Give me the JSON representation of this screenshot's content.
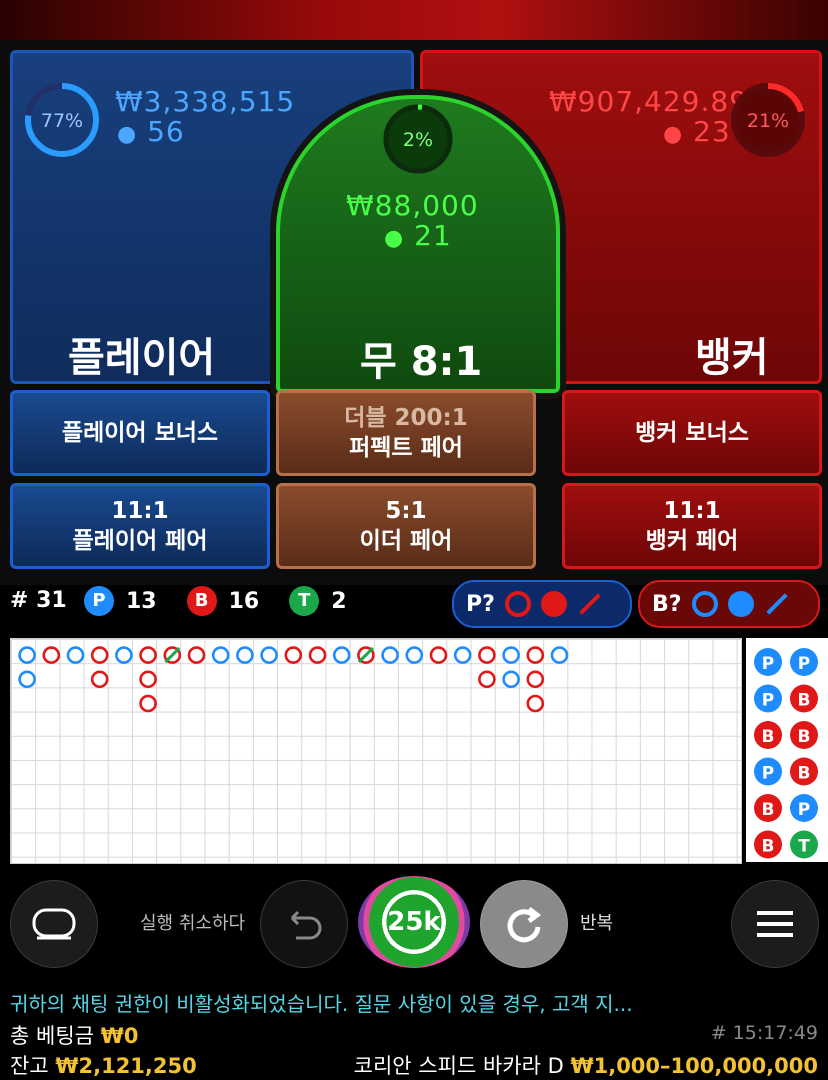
{
  "player": {
    "percent": "77%",
    "percent_value": 0.77,
    "amount": "₩3,338,515",
    "count": "56",
    "label": "플레이어"
  },
  "tie": {
    "percent": "2%",
    "percent_value": 0.02,
    "amount": "₩88,000",
    "count": "21",
    "label": "무 8:1"
  },
  "banker": {
    "percent": "21%",
    "percent_value": 0.21,
    "amount": "₩907,429.89",
    "count": "23",
    "label": "뱅커"
  },
  "side_bets": {
    "player_bonus": "플레이어 보너스",
    "perfect_pair_odds": "더블 200:1",
    "perfect_pair": "퍼펙트 페어",
    "banker_bonus": "뱅커 보너스",
    "player_pair_odds": "11:1",
    "player_pair": "플레이어 페어",
    "either_pair_odds": "5:1",
    "either_pair": "이더 페어",
    "banker_pair_odds": "11:1",
    "banker_pair": "뱅커 페어"
  },
  "stats": {
    "rounds": "# 31",
    "player_letter": "P",
    "player_wins": "13",
    "banker_letter": "B",
    "banker_wins": "16",
    "tie_letter": "T",
    "ties": "2",
    "player_predict": "P?",
    "banker_predict": "B?"
  },
  "controls": {
    "undo": "실행 취소하다",
    "chip": "25k",
    "repeat": "반복"
  },
  "chat_notice": "귀하의 채팅 권한이 비활성화되었습니다. 질문 사항이 있을 경우, 고객 지...",
  "footer": {
    "total_bet_label": "총 베팅금",
    "total_bet": "₩0",
    "game_id": "# 15:17:49",
    "balance_label": "잔고",
    "balance": "₩2,121,250",
    "table_name": "코리안 스피드 바카라 D",
    "limits": "₩1,000–100,000,000"
  },
  "colors": {
    "player": "#1e8cff",
    "banker": "#e01818",
    "tie": "#1aa84a",
    "chat": "#55d6e6",
    "gold": "#f2c230"
  },
  "big_road": {
    "cols": [
      [
        "P",
        "P"
      ],
      [
        "B"
      ],
      [
        "P"
      ],
      [
        "B",
        "B"
      ],
      [
        "P"
      ],
      [
        "B",
        "B",
        "B"
      ],
      [
        "B"
      ],
      [
        "B"
      ],
      [
        "P"
      ],
      [
        "P"
      ],
      [
        "P"
      ],
      [
        "B"
      ],
      [
        "B"
      ],
      [
        "P"
      ],
      [
        "B"
      ],
      [
        "P"
      ],
      [
        "P"
      ],
      [
        "B"
      ],
      [
        "P"
      ],
      [
        "B",
        "B"
      ],
      [
        "P",
        "P"
      ],
      [
        "B",
        "B",
        "B"
      ],
      [
        "P"
      ]
    ],
    "tie_marks": [
      6,
      14
    ]
  },
  "bead_road_partial": [
    [
      "P",
      "P"
    ],
    [
      "P",
      "B"
    ],
    [
      "B",
      "B"
    ],
    [
      "P",
      "B"
    ],
    [
      "B",
      "P"
    ],
    [
      "B",
      "T"
    ]
  ]
}
